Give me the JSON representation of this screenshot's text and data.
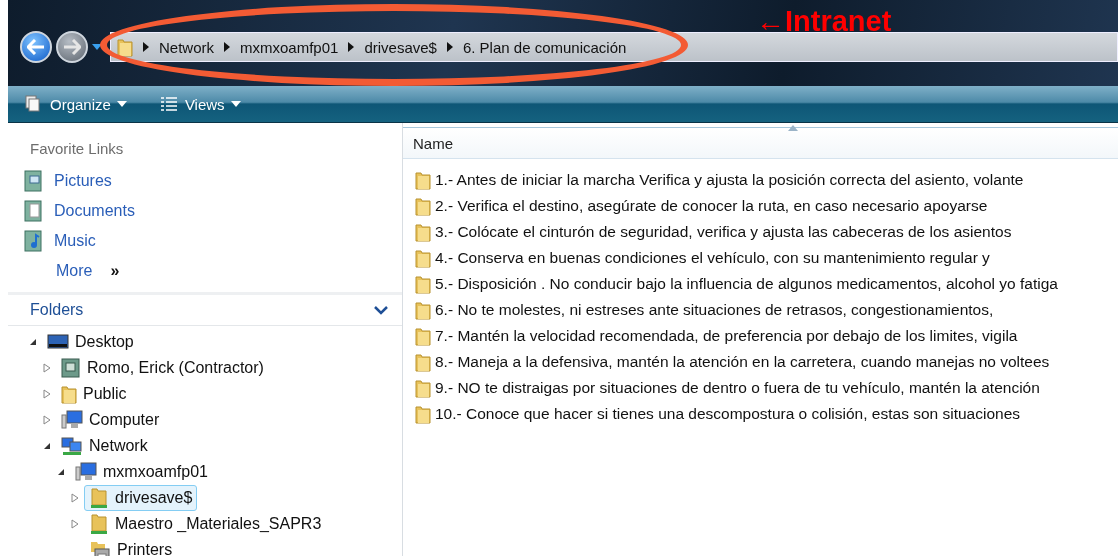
{
  "address_bar": {
    "crumbs": [
      "Network",
      "mxmxoamfp01",
      "drivesave$",
      "6. Plan de comunicación"
    ]
  },
  "toolbar": {
    "buttons": [
      {
        "label": "Organize",
        "kind": "organize"
      },
      {
        "label": "Views",
        "kind": "views"
      }
    ]
  },
  "sidebar": {
    "favorites_title": "Favorite Links",
    "favorites": [
      {
        "label": "Pictures",
        "kind": "pictures"
      },
      {
        "label": "Documents",
        "kind": "documents"
      },
      {
        "label": "Music",
        "kind": "music"
      },
      {
        "label": "More",
        "kind": "more",
        "glyph": "»"
      }
    ],
    "folders_title": "Folders",
    "tree": [
      {
        "label": "Desktop",
        "kind": "desktop",
        "expanded": true,
        "selected": false,
        "children": [
          {
            "label": "Romo, Erick (Contractor)",
            "kind": "contact",
            "expanded": false,
            "selected": false
          },
          {
            "label": "Public",
            "kind": "folder",
            "expanded": false,
            "selected": false
          },
          {
            "label": "Computer",
            "kind": "computer",
            "expanded": false,
            "selected": false
          },
          {
            "label": "Network",
            "kind": "network",
            "expanded": true,
            "selected": false,
            "children": [
              {
                "label": "mxmxoamfp01",
                "kind": "computer",
                "expanded": true,
                "selected": false,
                "children": [
                  {
                    "label": "drivesave$",
                    "kind": "share",
                    "expanded": false,
                    "selected": true
                  },
                  {
                    "label": "Maestro _Materiales_SAPR3",
                    "kind": "share",
                    "expanded": false,
                    "selected": false
                  },
                  {
                    "label": "Printers",
                    "kind": "printer",
                    "selected": false
                  }
                ]
              }
            ]
          }
        ]
      }
    ]
  },
  "file_list": {
    "columns": [
      "Name"
    ],
    "rows": [
      "1.- Antes de iniciar la marcha Verifica y ajusta la posición correcta del asiento, volante",
      "2.- Verifica el destino, asegúrate de conocer la ruta, en caso necesario apoyarse",
      "3.- Colócate el cinturón de seguridad, verifica y ajusta las cabeceras de los asientos",
      "4.- Conserva en buenas condiciones el vehículo, con su mantenimiento regular y",
      "5.- Disposición . No conducir bajo la influencia de algunos medicamentos, alcohol yo fatiga",
      "6.- No te molestes, ni estreses ante situaciones de retrasos, congestionamientos,",
      "7.- Mantén la velocidad recomendada, de preferencia por debajo de los limites, vigila",
      "8.- Maneja a la defensiva, mantén la atención en la carretera, cuando manejas no voltees",
      "9.- NO te distraigas por situaciones de dentro o fuera de tu vehículo, mantén la atención",
      "10.- Conoce que hacer si tienes una descompostura o colisión, estas son situaciones"
    ]
  },
  "annotation": {
    "label": "←Intranet"
  }
}
